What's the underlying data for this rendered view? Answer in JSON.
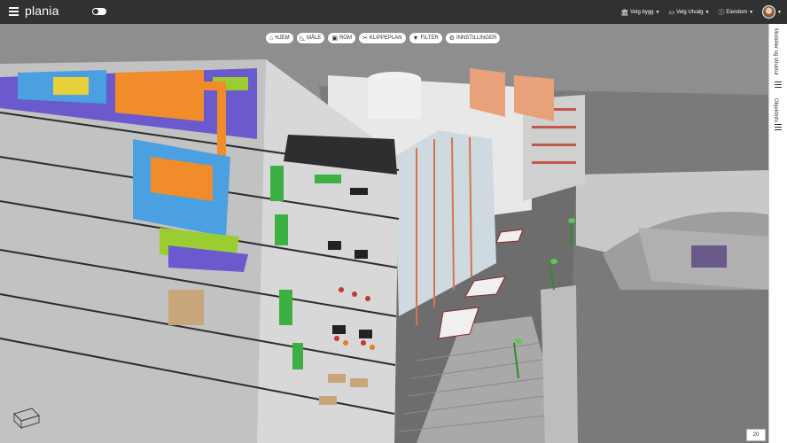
{
  "header": {
    "logo": "plania",
    "menus": [
      {
        "icon": "building-icon",
        "label": "Velg bygg"
      },
      {
        "icon": "monitor-icon",
        "label": "Velg Utvalg"
      },
      {
        "icon": "info-icon",
        "label": "Eiendom"
      }
    ]
  },
  "toolbar": {
    "buttons": [
      {
        "icon": "home-icon",
        "label": "HJEM"
      },
      {
        "icon": "ruler-icon",
        "label": "MÅLE"
      },
      {
        "icon": "room-icon",
        "label": "ROM"
      },
      {
        "icon": "scissors-icon",
        "label": "KLIPPEPLAN"
      },
      {
        "icon": "filter-icon",
        "label": "FILTER"
      },
      {
        "icon": "gear-icon",
        "label": "INNSTILLINGER"
      }
    ]
  },
  "side_panel": {
    "tabs": [
      "Modeller og struktur",
      "Objektinfo"
    ]
  },
  "viewer": {
    "zoom_value": "20"
  },
  "colors": {
    "topbar": "#2f3133",
    "background": "#8f8f8f",
    "toolbar_button": "#ffffff"
  }
}
